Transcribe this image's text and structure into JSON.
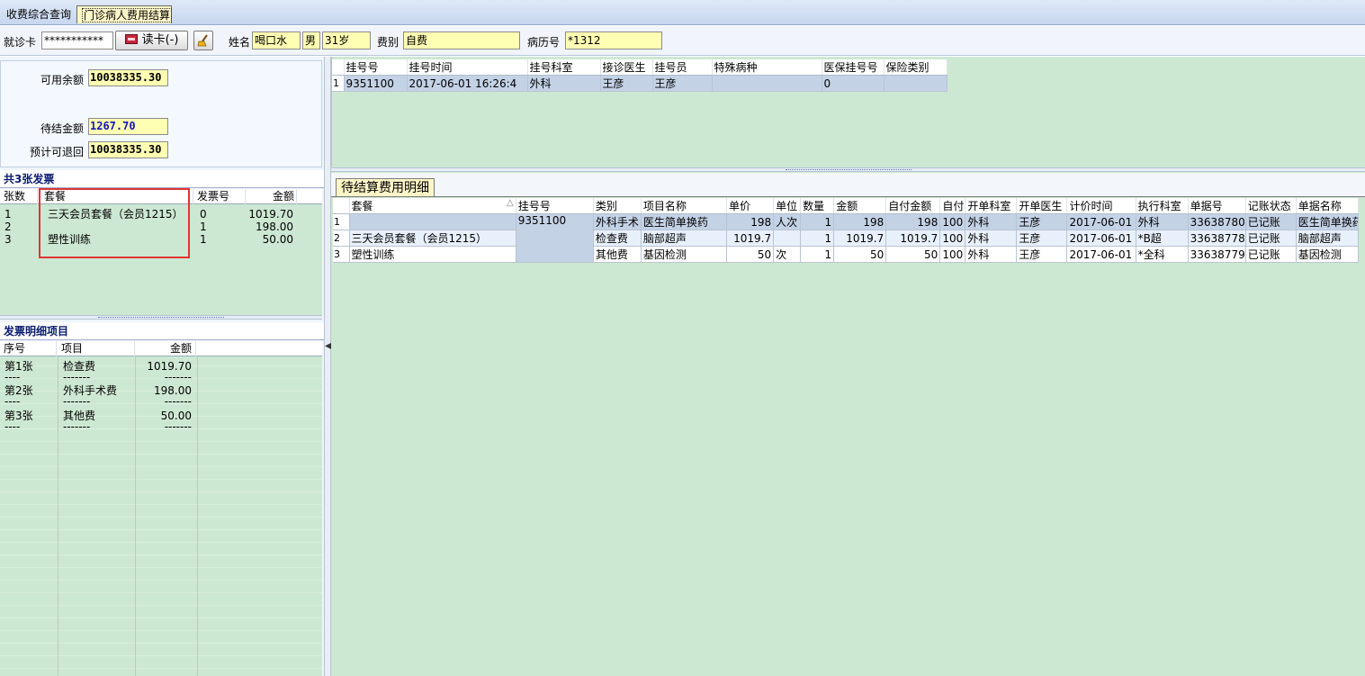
{
  "tabs": [
    {
      "label": "收费综合查询",
      "active": false
    },
    {
      "label": "门诊病人费用结算",
      "active": true
    }
  ],
  "patient": {
    "card_label": "就诊卡",
    "card_value": "***********",
    "read_card_button": "读卡(-)",
    "name_label": "姓名",
    "name_value": "喝口水",
    "sex_value": "男",
    "age_value": "31岁",
    "fee_type_label": "费别",
    "fee_type_value": "自费",
    "record_label": "病历号",
    "record_value": "*1312"
  },
  "summary": {
    "available_label": "可用余额",
    "available_value": "10038335.30",
    "pending_label": "待结金额",
    "pending_value": "1267.70",
    "refundable_label": "预计可退回",
    "refundable_value": "10038335.30"
  },
  "invoices": {
    "title": "共3张发票",
    "columns": [
      "张数",
      "套餐",
      "发票号",
      "金额"
    ],
    "rows": [
      {
        "no": "1",
        "package": "三天会员套餐（会员1215）",
        "invoice": "0",
        "amount": "1019.70"
      },
      {
        "no": "2",
        "package": "",
        "invoice": "1",
        "amount": "198.00"
      },
      {
        "no": "3",
        "package": "塑性训练",
        "invoice": "1",
        "amount": "50.00"
      }
    ]
  },
  "invoice_detail": {
    "title": "发票明细项目",
    "columns": [
      "序号",
      "项目",
      "金额"
    ],
    "rows": [
      {
        "no": "第1张",
        "item": "检查费",
        "amount": "1019.70"
      },
      {
        "no": "----",
        "item": "-------",
        "amount": "-------"
      },
      {
        "no": "第2张",
        "item": "外科手术费",
        "amount": "198.00"
      },
      {
        "no": "----",
        "item": "-------",
        "amount": "-------"
      },
      {
        "no": "第3张",
        "item": "其他费",
        "amount": "50.00"
      },
      {
        "no": "----",
        "item": "-------",
        "amount": "-------"
      }
    ]
  },
  "registration": {
    "columns": [
      "挂号号",
      "挂号时间",
      "挂号科室",
      "接诊医生",
      "挂号员",
      "特殊病种",
      "医保挂号号",
      "保险类别"
    ],
    "rows": [
      {
        "rn": "1",
        "cells": [
          "9351100",
          "2017-06-01 16:26:4",
          "外科",
          "王彦",
          "王彦",
          "",
          "0",
          ""
        ]
      }
    ]
  },
  "pending_fees": {
    "tab_label": "待结算费用明细",
    "columns": [
      "套餐",
      "挂号号",
      "类别",
      "项目名称",
      "单价",
      "单位",
      "数量",
      "金额",
      "自付金额",
      "自付",
      "开单科室",
      "开单医生",
      "计价时间",
      "执行科室",
      "单据号",
      "记账状态",
      "单据名称"
    ],
    "rows": [
      {
        "rn": "1",
        "cells": [
          "",
          "9351100",
          "外科手术",
          "医生简单换药",
          "198",
          "人次",
          "1",
          "198",
          "198",
          "100",
          "外科",
          "王彦",
          "2017-06-01",
          "外科",
          "33638780",
          "已记账",
          "医生简单换药"
        ]
      },
      {
        "rn": "2",
        "cells": [
          "三天会员套餐（会员1215）",
          "",
          "检查费",
          "脑部超声",
          "1019.7",
          "",
          "1",
          "1019.7",
          "1019.7",
          "100",
          "外科",
          "王彦",
          "2017-06-01",
          "*B超",
          "33638778",
          "已记账",
          "脑部超声"
        ]
      },
      {
        "rn": "3",
        "cells": [
          "塑性训练",
          "",
          "其他费",
          "基因检测",
          "50",
          "次",
          "1",
          "50",
          "50",
          "100",
          "外科",
          "王彦",
          "2017-06-01",
          "*全科",
          "33638779",
          "已记账",
          "基因检测"
        ]
      }
    ]
  }
}
